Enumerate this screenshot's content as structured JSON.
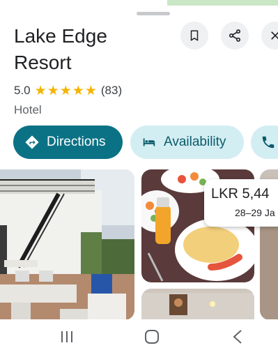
{
  "place": {
    "name_line1": "Lake Edge",
    "name_line2": "Resort",
    "rating": "5.0",
    "review_count": "(83)",
    "category": "Hotel"
  },
  "actions": {
    "directions_label": "Directions",
    "availability_label": "Availability"
  },
  "price_card": {
    "price": "LKR 5,44",
    "dates": "28–29 Ja"
  },
  "icons": [
    "bookmark-icon",
    "share-icon",
    "close-icon",
    "directions-icon",
    "bed-icon",
    "phone-icon",
    "recents-icon",
    "home-icon",
    "back-icon"
  ],
  "colors": {
    "primary": "#0b7285",
    "chip_bg": "#d3eef3",
    "star": "#f4b400"
  }
}
